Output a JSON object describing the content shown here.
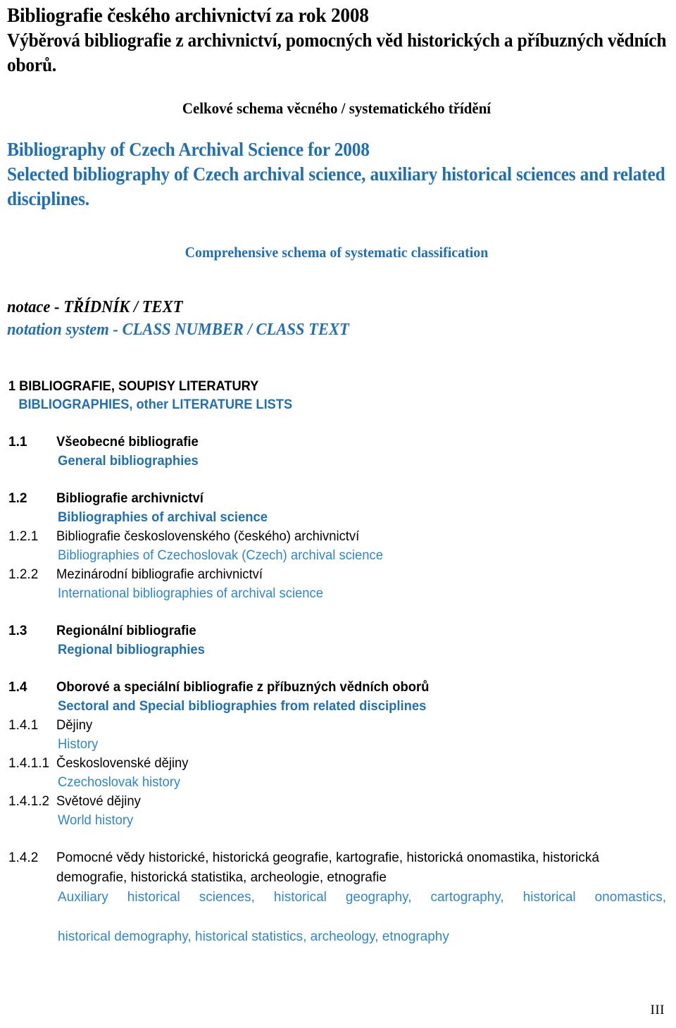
{
  "document": {
    "title_cz_line1": "Bibliografie českého archivnictví za rok 2008",
    "title_cz_line2": "Výběrová bibliografie z archivnictví, pomocných věd historických a příbuzných vědních oborů.",
    "center_head_cz": "Celkové schema věcného / systematického třídění",
    "title_en": "Bibliography of Czech Archival Science for 2008 Selected bibliography of Czech archival science, auxiliary historical sciences and related disciplines.",
    "title_en_line1": "Bibliography of Czech Archival Science for 2008",
    "title_en_line2": "Selected bibliography of Czech archival science, auxiliary historical sciences and related disciplines.",
    "center_head_en": "Comprehensive schema of systematic classification",
    "notation_cz": "notace - TŘÍDNÍK / TEXT",
    "notation_en": "notation system - CLASS NUMBER / CLASS TEXT",
    "page_number": "III"
  },
  "colors": {
    "blue_bold": "#1F6FB5",
    "blue_light": "#2E86C8",
    "black": "#000000",
    "background": "#FFFFFF"
  },
  "outline": {
    "section_heading": {
      "cz": "1 BIBLIOGRAFIE, SOUPISY LITERATURY",
      "en": "BIBLIOGRAPHIES, other LITERATURE LISTS"
    },
    "entries": [
      {
        "number": "1.1",
        "cz": "Všeobecné bibliografie",
        "en": "General bibliographies",
        "level": 2
      },
      {
        "number": "1.2",
        "cz": "Bibliografie archivnictví",
        "en": "Bibliographies of archival science",
        "level": 2
      },
      {
        "number": "1.2.1",
        "cz": "Bibliografie československého (českého) archivnictví",
        "en": "Bibliographies of Czechoslovak (Czech) archival science",
        "level": 3
      },
      {
        "number": "1.2.2",
        "cz": "Mezinárodní bibliografie archivnictví",
        "en": "International bibliographies of archival science",
        "level": 3
      },
      {
        "number": "1.3",
        "cz": "Regionální bibliografie",
        "en": "Regional bibliographies",
        "level": 2
      },
      {
        "number": "1.4",
        "cz": "Oborové a speciální bibliografie z příbuzných vědních oborů",
        "en": "Sectoral and Special bibliographies from related disciplines",
        "level": 2
      },
      {
        "number": "1.4.1",
        "cz": "Dějiny",
        "en": "History",
        "level": 3
      },
      {
        "number": "1.4.1.1",
        "cz": "Československé dějiny",
        "en": "Czechoslovak history",
        "level": 3
      },
      {
        "number": "1.4.1.2",
        "cz": "Světové dějiny",
        "en": "World history",
        "level": 3
      },
      {
        "number": "1.4.2",
        "cz": "Pomocné vědy historické, historická geografie, kartografie, historická onomastika, historická demografie, historická statistika, archeologie, etnografie",
        "en_line1": "Auxiliary historical sciences, historical geography, cartography, historical onomastics,",
        "en_line2": "historical demography, historical statistics, archeology, etnography",
        "en": "Auxiliary historical sciences, historical geography, cartography, historical onomastics, historical demography, historical statistics, archeology, etnography",
        "level": 3
      }
    ]
  }
}
